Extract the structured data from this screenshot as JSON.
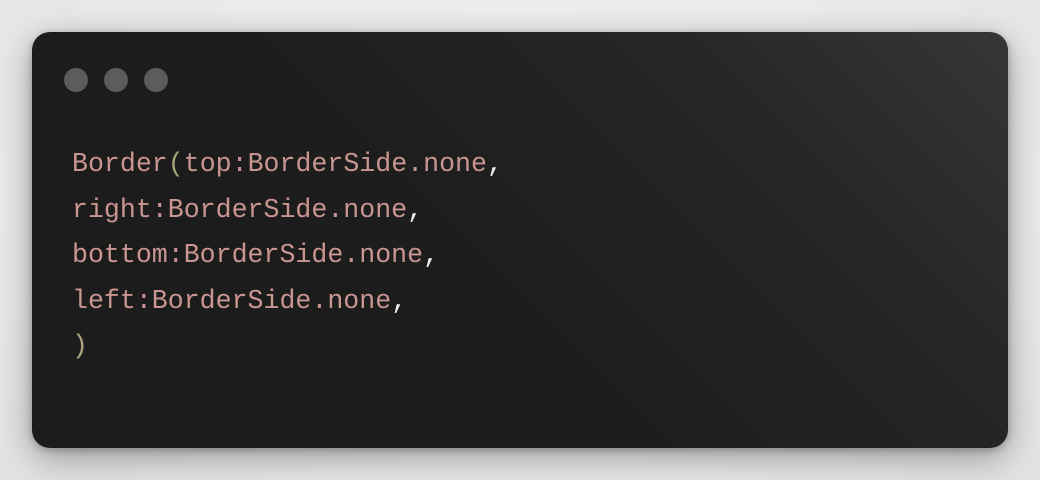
{
  "colors": {
    "identifier": "#c99590",
    "paren": "#a8a37e",
    "comma": "#efefef",
    "dot_1": "#5c5c5c",
    "dot_2": "#5c5c5c",
    "dot_3": "#5c5c5c"
  },
  "window": {
    "controls": [
      {
        "name": "window-dot-1"
      },
      {
        "name": "window-dot-2"
      },
      {
        "name": "window-dot-3"
      }
    ]
  },
  "code": {
    "lines": [
      {
        "ident": "Border",
        "paren": "(",
        "rest": "top:BorderSide.none",
        "comma": ","
      },
      {
        "ident": "",
        "paren": "",
        "rest": "right:BorderSide.none",
        "comma": ","
      },
      {
        "ident": "",
        "paren": "",
        "rest": "bottom:BorderSide.none",
        "comma": ","
      },
      {
        "ident": "",
        "paren": "",
        "rest": "left:BorderSide.none",
        "comma": ","
      },
      {
        "ident": "",
        "paren": ")",
        "rest": "",
        "comma": ""
      }
    ]
  }
}
